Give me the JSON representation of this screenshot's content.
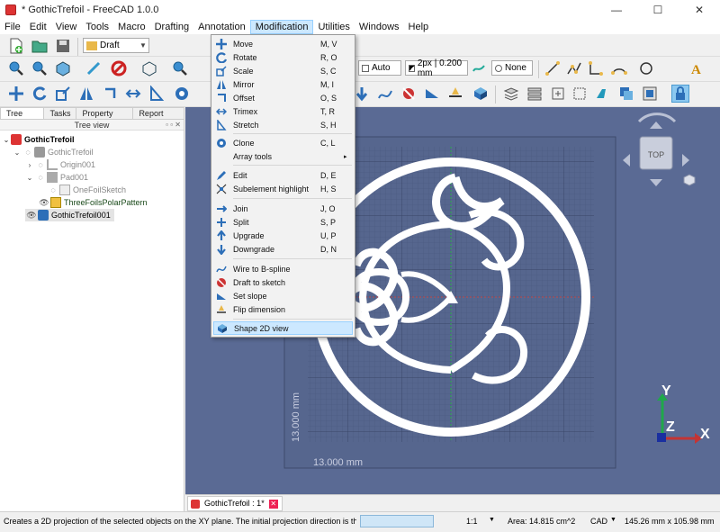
{
  "window": {
    "title": "* GothicTrefoil - FreeCAD 1.0.0",
    "minimize": "—",
    "maximize": "☐",
    "close": "✕"
  },
  "menubar": [
    "File",
    "Edit",
    "View",
    "Tools",
    "Macro",
    "Drafting",
    "Annotation",
    "Modification",
    "Utilities",
    "Windows",
    "Help"
  ],
  "toolbar": {
    "workbench": "Draft",
    "snap_mode": "Auto",
    "line_style": "2px | 0.200 mm",
    "fill": "None"
  },
  "left_panel": {
    "tabs": [
      "Tree view",
      "Tasks",
      "Property view",
      "Report view"
    ],
    "header": "Tree view",
    "tree": [
      {
        "label": "GothicTrefoil"
      },
      {
        "label": "GothicTrefoil"
      },
      {
        "label": "Origin001"
      },
      {
        "label": "Pad001"
      },
      {
        "label": "OneFoilSketch"
      },
      {
        "label": "ThreeFoilsPolarPattern"
      },
      {
        "label": "GothicTrefoil001"
      }
    ]
  },
  "viewport": {
    "dim_horizontal": "13.000 mm",
    "dim_vertical": "13.000 mm",
    "navcube_face": "TOP",
    "axis_x": "X",
    "axis_y": "Y",
    "axis_z": "Z",
    "colors": {
      "background": "#5a6a94",
      "part": "#ffffff",
      "grid": "#3c4a6c"
    }
  },
  "modification_menu": [
    {
      "label": "Move",
      "shortcut": "M, V",
      "icon": "move-icon"
    },
    {
      "label": "Rotate",
      "shortcut": "R, O",
      "icon": "rotate-icon"
    },
    {
      "label": "Scale",
      "shortcut": "S, C",
      "icon": "scale-icon"
    },
    {
      "label": "Mirror",
      "shortcut": "M, I",
      "icon": "mirror-icon"
    },
    {
      "label": "Offset",
      "shortcut": "O, S",
      "icon": "offset-icon"
    },
    {
      "label": "Trimex",
      "shortcut": "T, R",
      "icon": "trimex-icon"
    },
    {
      "label": "Stretch",
      "shortcut": "S, H",
      "icon": "stretch-icon"
    },
    {
      "label": "Clone",
      "shortcut": "C, L",
      "icon": "clone-icon"
    },
    {
      "label": "Array tools",
      "shortcut": "",
      "icon": "",
      "submenu": true
    },
    {
      "label": "Edit",
      "shortcut": "D, E",
      "icon": "edit-icon"
    },
    {
      "label": "Subelement highlight",
      "shortcut": "H, S",
      "icon": "subelement-icon"
    },
    {
      "label": "Join",
      "shortcut": "J, O",
      "icon": "join-icon"
    },
    {
      "label": "Split",
      "shortcut": "S, P",
      "icon": "split-icon"
    },
    {
      "label": "Upgrade",
      "shortcut": "U, P",
      "icon": "upgrade-icon"
    },
    {
      "label": "Downgrade",
      "shortcut": "D, N",
      "icon": "downgrade-icon"
    },
    {
      "label": "Wire to B-spline",
      "shortcut": "",
      "icon": "wire-bspline-icon"
    },
    {
      "label": "Draft to sketch",
      "shortcut": "",
      "icon": "draft-sketch-icon"
    },
    {
      "label": "Set slope",
      "shortcut": "",
      "icon": "slope-icon"
    },
    {
      "label": "Flip dimension",
      "shortcut": "",
      "icon": "flip-dimension-icon"
    },
    {
      "label": "Shape 2D view",
      "shortcut": "",
      "icon": "shape2d-icon",
      "highlighted": true
    }
  ],
  "doc_tab": {
    "label": "GothicTrefoil : 1*"
  },
  "statusbar": {
    "message": "Creates a 2D projection of the selected objects on the XY plane. The initial projection direction is the negativ",
    "zoom": "1:1",
    "area": "Area: 14.815 cm^2",
    "nav_style": "CAD",
    "dimensions": "145.26 mm x 105.98 mm"
  }
}
